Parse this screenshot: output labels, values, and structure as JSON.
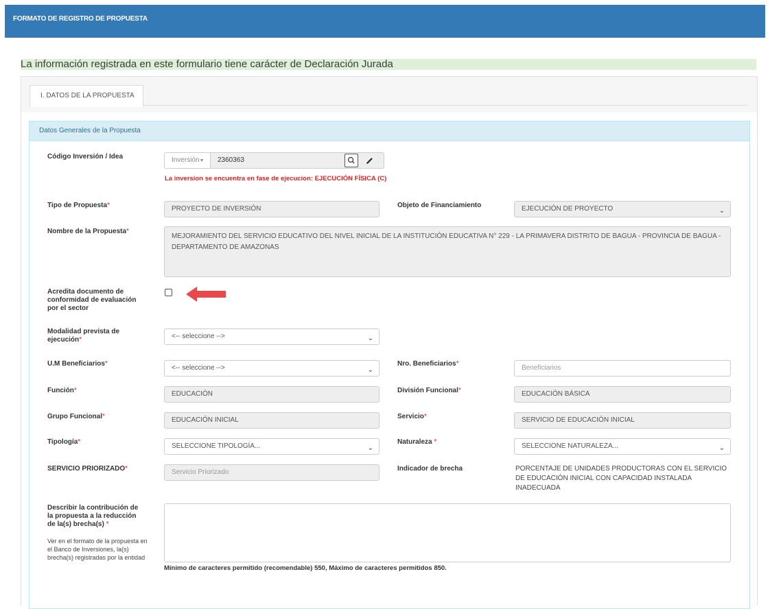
{
  "header": {
    "title": "FORMATO DE REGISTRO DE PROPUESTA"
  },
  "notice": "La información registrada en este formulario tiene carácter de Declaración Jurada",
  "tab": {
    "label": "I. DATOS DE LA PROPUESTA"
  },
  "section": {
    "title": "Datos Generales de la Propuesta"
  },
  "codigo": {
    "label": "Código Inversión / Idea",
    "type_label": "Inversión",
    "value": "2360363",
    "warning": "La inversion se encuentra en fase de ejecucion: EJECUCIÓN FÍSICA (C)"
  },
  "tipo": {
    "label": "Tipo de Propuesta",
    "value": "PROYECTO DE INVERSIÓN"
  },
  "objeto": {
    "label": "Objeto de Financiamiento",
    "value": "EJECUCIÓN DE PROYECTO"
  },
  "nombre": {
    "label": "Nombre de la Propuesta",
    "value": "MEJORAMIENTO DEL SERVICIO EDUCATIVO DEL NIVEL INICIAL DE LA INSTITUCIÓN EDUCATIVA N° 229 - LA PRIMAVERA  DISTRITO DE BAGUA - PROVINCIA DE BAGUA - DEPARTAMENTO DE AMAZONAS"
  },
  "acredita": {
    "label_1": "Acredita documento de",
    "label_2": "conformidad de evaluación",
    "label_3": "por el sector"
  },
  "modalidad": {
    "label_1": "Modalidad prevista de",
    "label_2": "ejecución",
    "value": "<-- seleccione -->"
  },
  "um": {
    "label": "U.M Beneficiarios",
    "value": "<-- seleccione -->"
  },
  "nro": {
    "label": "Nro. Beneficiarios",
    "placeholder": "Beneficiarios"
  },
  "funcion": {
    "label": "Función",
    "value": "EDUCACIÓN"
  },
  "division": {
    "label": "División Funcional",
    "value": "EDUCACIÓN BÁSICA"
  },
  "grupo": {
    "label": "Grupo Funcional",
    "value": "EDUCACIÓN INICIAL"
  },
  "servicio": {
    "label": "Servicio",
    "value": "SERVICIO DE EDUCACIÓN INICIAL"
  },
  "tipologia": {
    "label": "Tipología",
    "value": "SELECCIONE TIPOLOGÍA..."
  },
  "naturaleza": {
    "label": "Naturaleza",
    "value": "SELECCIONE NATURALEZA..."
  },
  "priorizado": {
    "label": "SERVICIO PRIORIZADO",
    "placeholder": "Servicio Priorizado"
  },
  "indicador": {
    "label": "Indicador de brecha",
    "value": "PORCENTAJE DE UNIDADES PRODUCTORAS CON EL SERVICIO DE EDUCACIÓN INICIAL CON CAPACIDAD INSTALADA INADECUADA"
  },
  "describir": {
    "label_1": "Describir la contribución de",
    "label_2": "la propuesta a la reducción",
    "label_3": "de la(s) brecha(s)",
    "help": "Ver en el formato de la propuesta en el Banco de Inversiones, la(s) brecha(s) registradas por la entidad",
    "limits": "Mínimo de caracteres permitido (recomendable) 550, Máximo de caracteres permitidos 850."
  },
  "required_mark": "*",
  "colors": {
    "header": "#337ab7",
    "notice_bg": "#dff0d8",
    "panel_head": "#d9edf7",
    "warning": "#e21e1e",
    "arrow": "#e8494b"
  },
  "icons": [
    "search-icon",
    "pencil-icon",
    "chevron-down-icon",
    "arrow-left-icon"
  ]
}
